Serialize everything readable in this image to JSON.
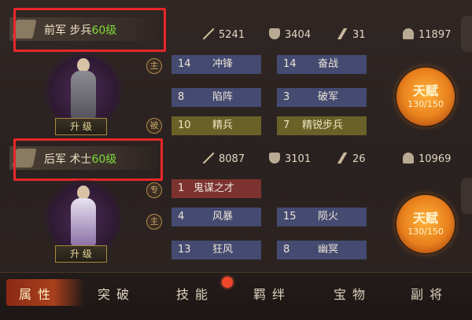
{
  "units": [
    {
      "name_prefix": "前军 步兵",
      "level": "60级",
      "stats": {
        "attack": "5241",
        "defense": "3404",
        "speed": "31",
        "troops": "11897"
      },
      "upgrade_label": "升 级",
      "tags": [
        "主",
        "被"
      ],
      "skills": [
        {
          "num": "14",
          "name": "冲锋"
        },
        {
          "num": "14",
          "name": "奋战"
        },
        {
          "num": "8",
          "name": "陷阵"
        },
        {
          "num": "3",
          "name": "破军"
        },
        {
          "num": "10",
          "name": "精兵"
        },
        {
          "num": "7",
          "name": "精锐步兵"
        }
      ],
      "talent": {
        "label": "天赋",
        "value": "130/150"
      }
    },
    {
      "name_prefix": "后军 术士",
      "level": "60级",
      "stats": {
        "attack": "8087",
        "defense": "3101",
        "speed": "26",
        "troops": "10969"
      },
      "upgrade_label": "升 级",
      "tags": [
        "专",
        "主"
      ],
      "skills": [
        {
          "num": "1",
          "name": "鬼谋之才"
        },
        {
          "num": "4",
          "name": "风暴"
        },
        {
          "num": "15",
          "name": "陨火"
        },
        {
          "num": "13",
          "name": "狂风"
        },
        {
          "num": "8",
          "name": "幽冥"
        }
      ],
      "talent": {
        "label": "天赋",
        "value": "130/150"
      }
    }
  ],
  "nav": [
    "属性",
    "突破",
    "技能",
    "羁绊",
    "宝物",
    "副将"
  ],
  "active_nav": "属性",
  "colors": {
    "level": "#7fdc3c",
    "highlight_box": "#e8272a",
    "notification_dot": "#f0472a"
  }
}
